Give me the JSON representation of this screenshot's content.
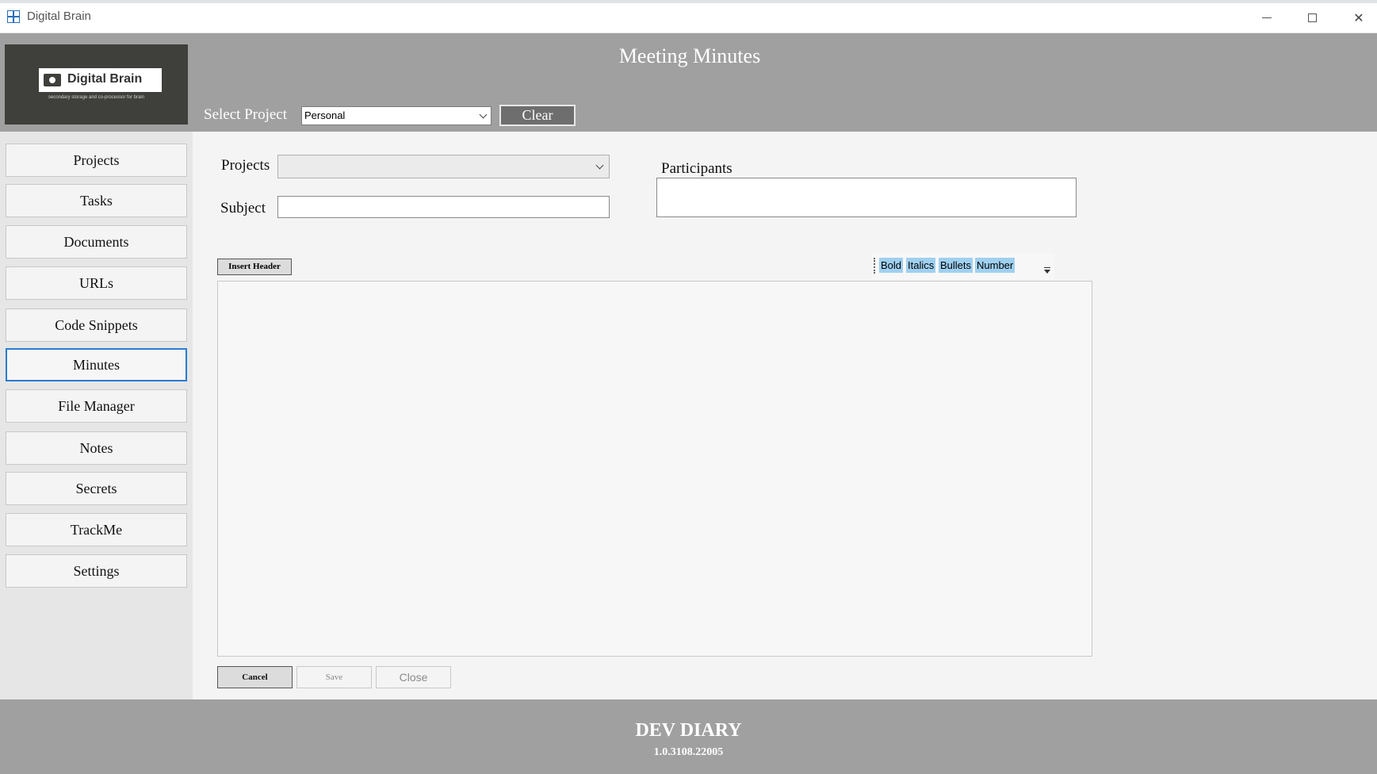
{
  "window": {
    "title": "Digital Brain",
    "minimize_icon": "minimize-icon",
    "maximize_icon": "maximize-icon",
    "close_icon": "close-icon"
  },
  "header": {
    "logo_name": "Digital Brain",
    "logo_tagline": "secondary storage and co-processor for brain",
    "page_title": "Meeting Minutes",
    "select_project_label": "Select Project",
    "select_project_value": "Personal",
    "clear_label": "Clear"
  },
  "sidebar": {
    "items": [
      {
        "label": "Projects",
        "active": false
      },
      {
        "label": "Tasks",
        "active": false
      },
      {
        "label": "Documents",
        "active": false
      },
      {
        "label": "URLs",
        "active": false
      },
      {
        "label": "Code Snippets",
        "active": false
      },
      {
        "label": "Minutes",
        "active": true
      },
      {
        "label": "File Manager",
        "active": false
      },
      {
        "label": "Notes",
        "active": false
      },
      {
        "label": "Secrets",
        "active": false
      },
      {
        "label": "TrackMe",
        "active": false
      },
      {
        "label": "Settings",
        "active": false
      }
    ]
  },
  "form": {
    "projects_label": "Projects",
    "projects_value": "",
    "subject_label": "Subject",
    "subject_value": "",
    "participants_label": "Participants",
    "participants_value": "",
    "insert_header_label": "Insert Header",
    "toolbar": {
      "bold": "Bold",
      "italics": "Italics",
      "bullets": "Bullets",
      "number": "Number"
    },
    "editor_value": "",
    "cancel_label": "Cancel",
    "save_label": "Save",
    "close_label": "Close"
  },
  "footer": {
    "title": "DEV DIARY",
    "version": "1.0.3108.22005"
  },
  "colors": {
    "header_bg": "#a0a0a0",
    "accent_active": "#2a7bd0",
    "toolbar_button": "#9fd0f0",
    "logo_bg": "#3f3f3b"
  }
}
